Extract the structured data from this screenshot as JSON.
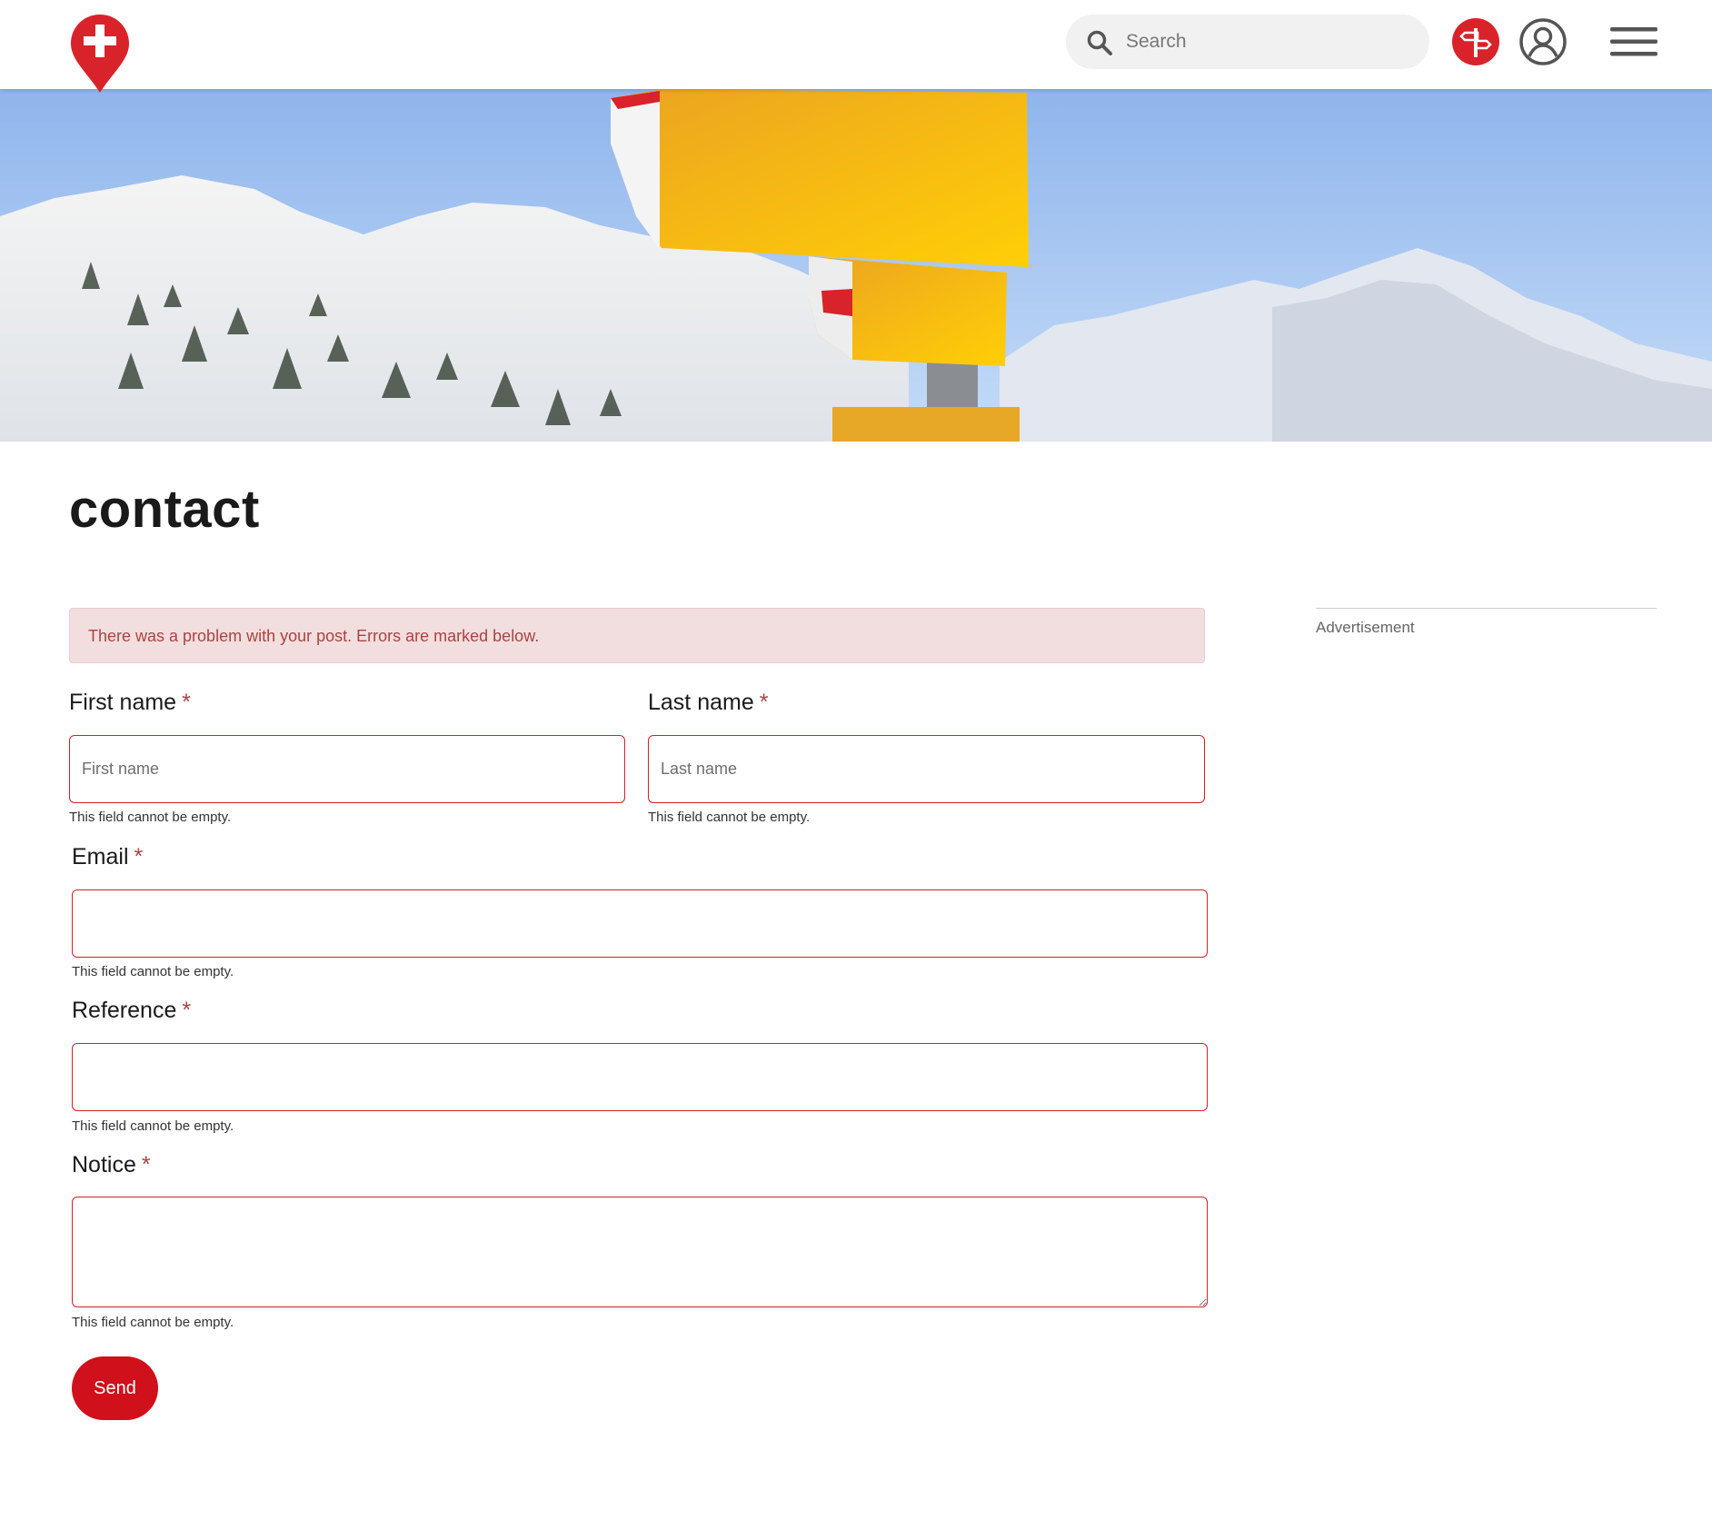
{
  "header": {
    "logo_name": "swiss-pin-logo",
    "search": {
      "placeholder": "Search",
      "value": ""
    },
    "icons": [
      "search-icon",
      "signpost-icon",
      "user-account-icon",
      "hamburger-menu-icon"
    ],
    "accent_color": "#d8232a"
  },
  "hero": {
    "description_icon": "mountain-signpost-image"
  },
  "page": {
    "title": "contact"
  },
  "alert": {
    "message": "There was a problem with your post. Errors are marked below.",
    "bg_color": "#f2dede",
    "text_color": "#a94442"
  },
  "sidebar": {
    "ad_label": "Advertisement"
  },
  "form": {
    "required_marker": "*",
    "first_name": {
      "label": "First name",
      "placeholder": "First name",
      "value": "",
      "error": "This field cannot be empty."
    },
    "last_name": {
      "label": "Last name",
      "placeholder": "Last name",
      "value": "",
      "error": "This field cannot be empty."
    },
    "email": {
      "label": "Email",
      "placeholder": "",
      "value": "",
      "error": "This field cannot be empty."
    },
    "reference": {
      "label": "Reference",
      "placeholder": "",
      "value": "",
      "error": "This field cannot be empty."
    },
    "notice": {
      "label": "Notice",
      "placeholder": "",
      "value": "",
      "error": "This field cannot be empty."
    },
    "send_label": "Send",
    "error_border_color": "#d0202b",
    "button_color": "#d0101b"
  }
}
